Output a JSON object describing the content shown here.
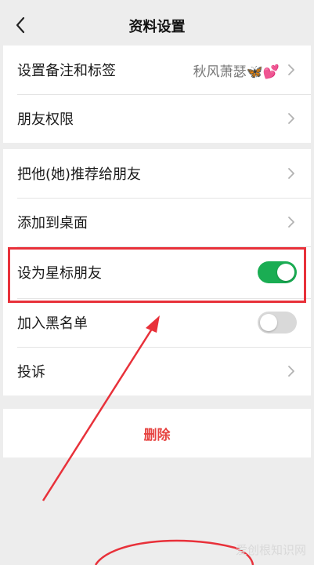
{
  "header": {
    "title": "资料设置",
    "back_icon": "chevron-left-icon"
  },
  "group1": [
    {
      "label": "设置备注和标签",
      "value": "秋风萧瑟🦋💕",
      "type": "arrow"
    },
    {
      "label": "朋友权限",
      "type": "arrow"
    }
  ],
  "group2": [
    {
      "label": "把他(她)推荐给朋友",
      "type": "arrow"
    },
    {
      "label": "添加到桌面",
      "type": "arrow"
    },
    {
      "label": "设为星标朋友",
      "type": "toggle",
      "on": true
    },
    {
      "label": "加入黑名单",
      "type": "toggle",
      "on": false
    },
    {
      "label": "投诉",
      "type": "arrow"
    }
  ],
  "delete": {
    "label": "删除"
  },
  "colors": {
    "toggle_on": "#1aad53",
    "danger": "#e64340",
    "annotation": "#e8313a"
  },
  "watermark": "爱创根知识网"
}
